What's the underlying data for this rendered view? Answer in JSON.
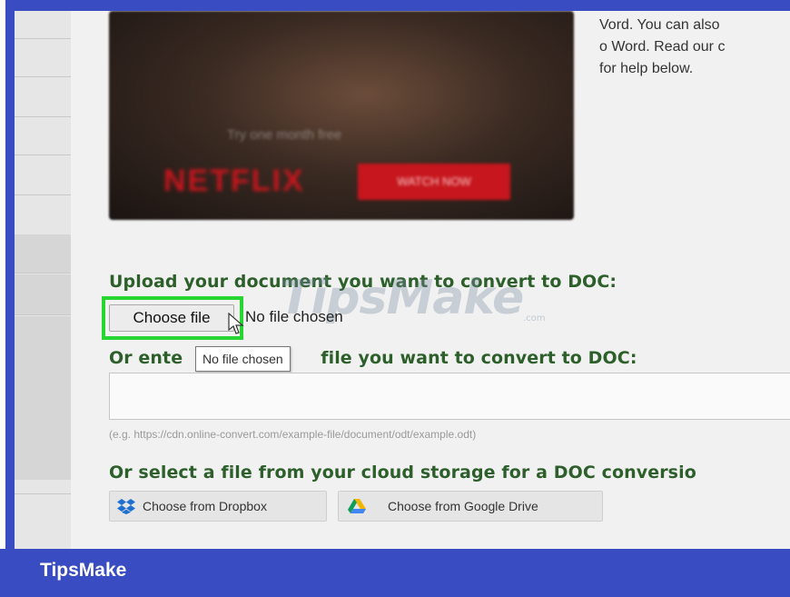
{
  "intro": {
    "lines": [
      "Vord. You can also",
      "o Word. Read our c",
      "for help below."
    ]
  },
  "video": {
    "caption": "Try one month free",
    "logo_text": "NETFLIX",
    "button_label": "WATCH NOW"
  },
  "upload": {
    "heading": "Upload your document you want to convert to DOC:",
    "choose_file_label": "Choose file",
    "file_status": "No file chosen",
    "tooltip": "No file chosen"
  },
  "url": {
    "heading": "Or enter URL of the file you want to convert to DOC:",
    "heading_left": "Or ente",
    "heading_right": "file you want to convert to DOC:",
    "input_value": "",
    "example": "(e.g. https://cdn.online-convert.com/example-file/document/odt/example.odt)"
  },
  "cloud": {
    "heading": "Or select a file from your cloud storage for a DOC conversio",
    "dropbox_label": "Choose from Dropbox",
    "gdrive_label": "Choose from Google Drive"
  },
  "watermark": {
    "main": "TipsMake",
    "sub": ".com"
  },
  "footer": {
    "brand": "TipsMake"
  },
  "colors": {
    "frame_blue": "#3a4cc2",
    "heading_green": "#2d5f2b",
    "highlight_green": "#28d631",
    "netflix_red": "#c7161d"
  }
}
